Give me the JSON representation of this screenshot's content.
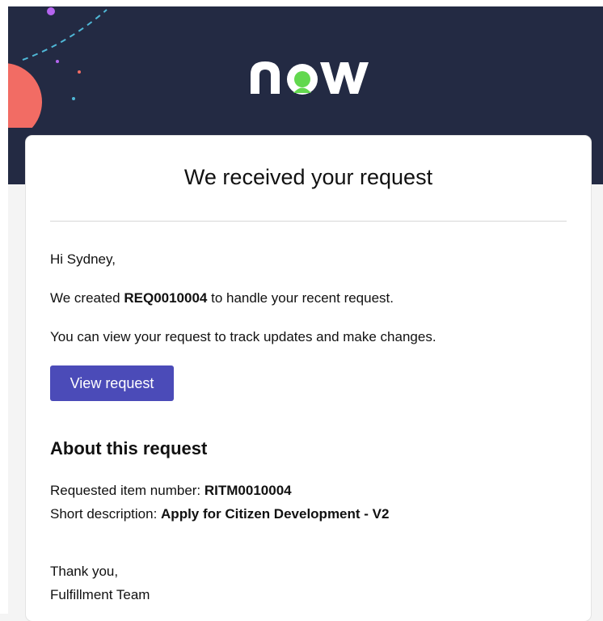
{
  "header": {
    "logo_text": "now",
    "logo_accent": "#62d84e"
  },
  "card": {
    "title": "We received your request",
    "greeting": "Hi Sydney,",
    "created_prefix": "We created",
    "request_number": "REQ0010004",
    "created_suffix": "to handle your recent request.",
    "view_text": "You can view your request to track updates and make changes.",
    "view_button": "View request",
    "about_title": "About this request",
    "item_label": "Requested item number:",
    "item_number": "RITM0010004",
    "desc_label": "Short description:",
    "desc_value": "Apply for Citizen Development - V2",
    "thanks": "Thank you,",
    "team": "Fulfillment Team"
  },
  "colors": {
    "header_bg": "#232a43",
    "button_bg": "#4b4bb8",
    "decor_coral": "#f26c64",
    "decor_purple": "#b565f0",
    "decor_teal": "#4fb7d6"
  }
}
